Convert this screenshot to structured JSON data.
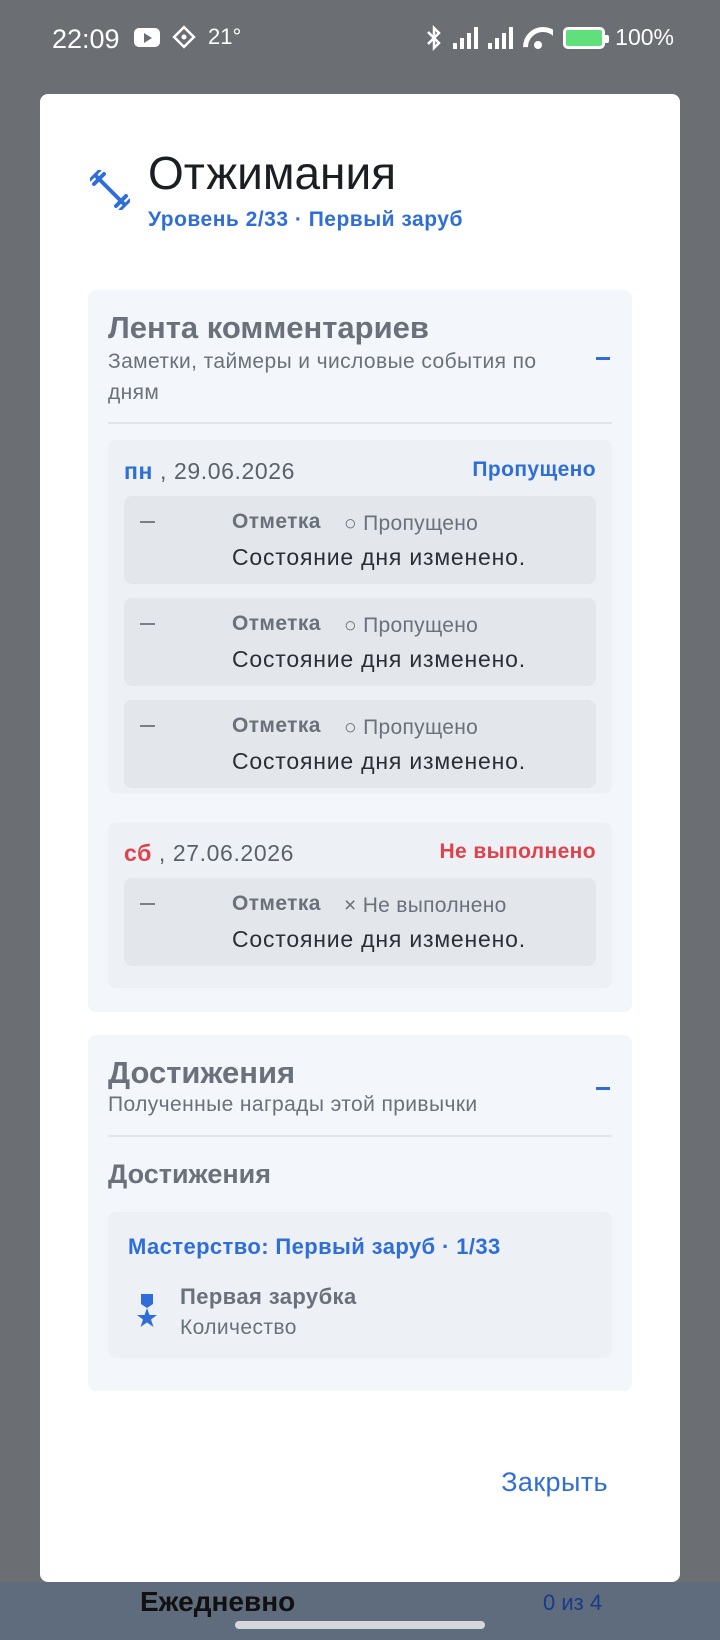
{
  "status_bar": {
    "time": "22:09",
    "temperature": "21°",
    "battery": "100%",
    "icons": [
      "youtube-icon",
      "app-icon",
      "bluetooth-icon",
      "signal-icon",
      "signal-icon",
      "wifi-icon",
      "battery-charging-icon"
    ]
  },
  "background": {
    "bottom_label": "Ежедневно",
    "bottom_count": "0 из 4"
  },
  "dialog": {
    "icon": "dumbbell-icon",
    "title": "Отжимания",
    "subtitle": "Уровень 2/33 · Первый заруб",
    "close_label": "Закрыть"
  },
  "comments": {
    "title": "Лента комментариев",
    "description": "Заметки, таймеры и числовые события по дням",
    "days": [
      {
        "weekday": "пн",
        "date": ", 29.06.2026",
        "status": "Пропущено",
        "status_color": "#2f6ed8",
        "entries": [
          {
            "label": "Отметка",
            "mark": "○ Пропущено",
            "text": "Состояние дня изменено."
          },
          {
            "label": "Отметка",
            "mark": "○ Пропущено",
            "text": "Состояние дня изменено."
          },
          {
            "label": "Отметка",
            "mark": "○ Пропущено",
            "text": "Состояние дня изменено."
          }
        ]
      },
      {
        "weekday": "сб",
        "date": ", 27.06.2026",
        "status": "Не выполнено",
        "status_color": "#e0414a",
        "entries": [
          {
            "label": "Отметка",
            "mark": "× Не выполнено",
            "text": "Состояние дня изменено."
          }
        ]
      }
    ]
  },
  "achievements": {
    "title": "Достижения",
    "description": "Полученные награды этой привычки",
    "subheading": "Достижения",
    "card": {
      "title": "Мастерство: Первый заруб · 1/33",
      "icon": "medal-icon",
      "name": "Первая зарубка",
      "meta": "Количество"
    }
  }
}
